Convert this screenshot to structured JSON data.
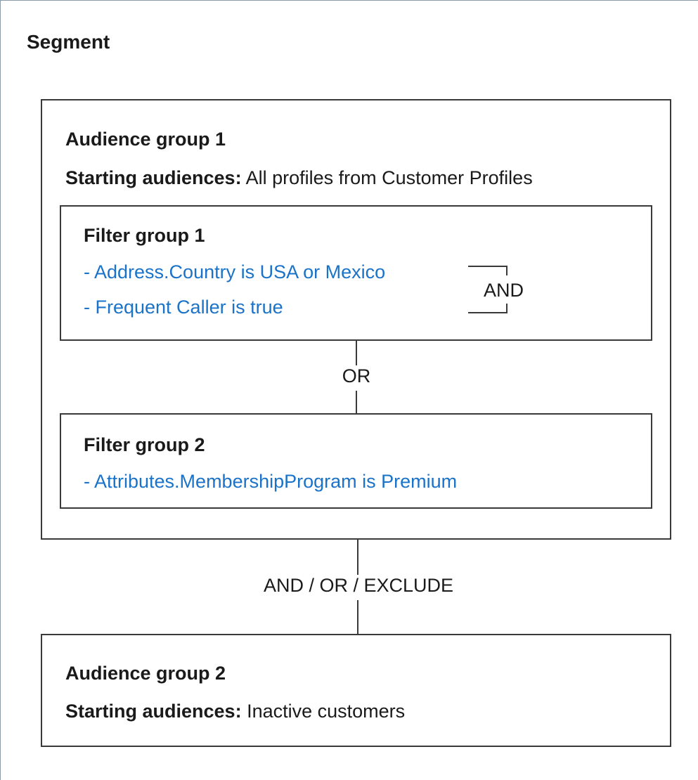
{
  "segment": {
    "title": "Segment"
  },
  "audience_group_1": {
    "heading": "Audience group 1",
    "starting_label": "Starting audiences:",
    "starting_value": "All profiles from Customer Profiles",
    "filter_group_1": {
      "heading": "Filter group 1",
      "filters": [
        "- Address.Country is USA or Mexico",
        "- Frequent Caller is true"
      ],
      "operator": "AND"
    },
    "between_filters": "OR",
    "filter_group_2": {
      "heading": "Filter group 2",
      "filters": [
        "- Attributes.MembershipProgram is Premium"
      ]
    }
  },
  "between_groups": "AND / OR / EXCLUDE",
  "audience_group_2": {
    "heading": "Audience group 2",
    "starting_label": "Starting audiences:",
    "starting_value": "Inactive customers"
  },
  "colors": {
    "filter_text": "#1a73c9",
    "border": "#3a3a3a"
  }
}
